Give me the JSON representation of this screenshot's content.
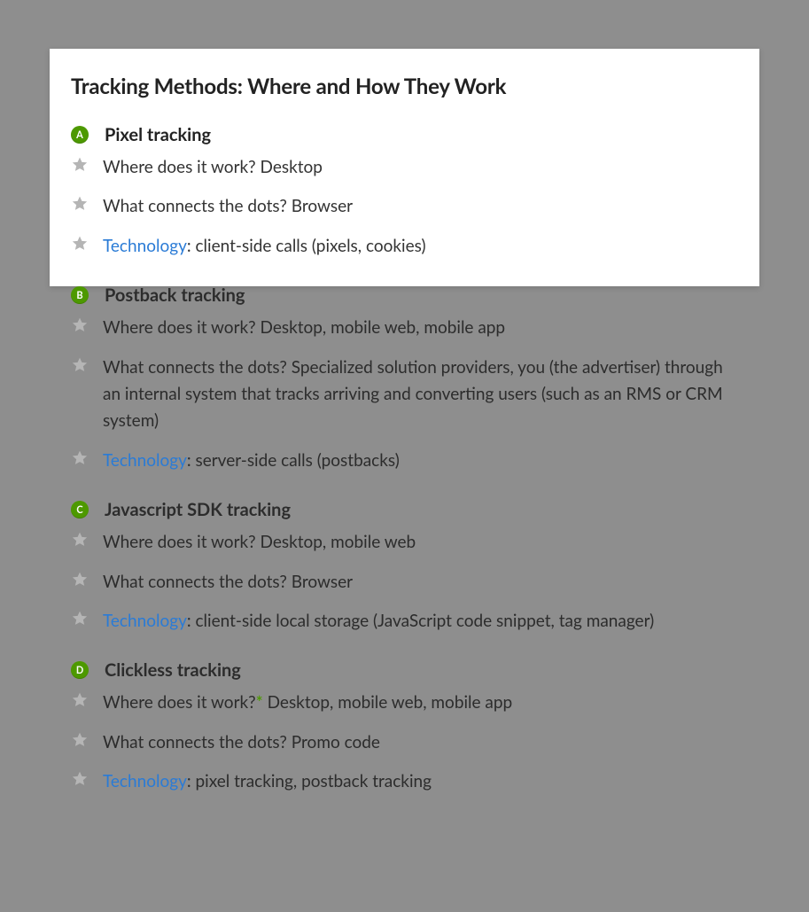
{
  "title": "Tracking Methods: Where and How They Work",
  "sections": [
    {
      "letter": "A",
      "name": "Pixel tracking",
      "rows": [
        {
          "prefixLink": "",
          "text": "Where does it work? Desktop"
        },
        {
          "prefixLink": "",
          "text": "What connects the dots? Browser"
        },
        {
          "prefixLink": "Technology",
          "text": ": client-side calls (pixels, cookies)"
        }
      ]
    },
    {
      "letter": "B",
      "name": "Postback tracking",
      "rows": [
        {
          "prefixLink": "",
          "text": "Where does it work? Desktop, mobile web, mobile app"
        },
        {
          "prefixLink": "",
          "text": "What connects the dots? Specialized solution providers, you (the advertiser) through an internal system that tracks arriving and converting users (such as an RMS or CRM system)"
        },
        {
          "prefixLink": "Technology",
          "text": ": server-side calls (postbacks)"
        }
      ]
    },
    {
      "letter": "C",
      "name": "Javascript SDK tracking",
      "rows": [
        {
          "prefixLink": "",
          "text": "Where does it work? Desktop, mobile web"
        },
        {
          "prefixLink": "",
          "text": "What connects the dots? Browser"
        },
        {
          "prefixLink": "Technology",
          "text": ": client-side local storage (JavaScript code snippet, tag manager)"
        }
      ]
    },
    {
      "letter": "D",
      "name": "Clickless tracking",
      "rows": [
        {
          "prefixLink": "",
          "asterisk": true,
          "preText": "Where does it work?",
          "text": " Desktop, mobile web, mobile app"
        },
        {
          "prefixLink": "",
          "text": "What connects the dots? Promo code"
        },
        {
          "prefixLink": "Technology",
          "text": ": pixel tracking, postback tracking"
        }
      ]
    }
  ]
}
